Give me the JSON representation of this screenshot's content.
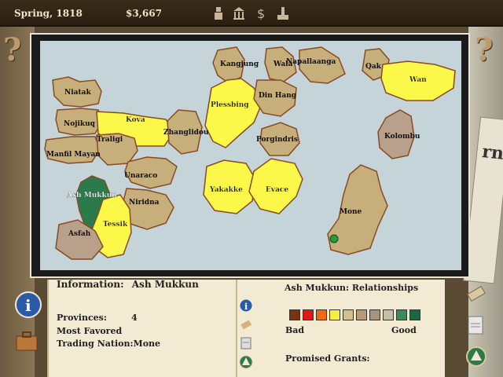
{
  "status": {
    "date": "Spring, 1818",
    "money": "$3,667"
  },
  "top_icons": [
    "figure-icon",
    "bank-icon",
    "dollar-icon",
    "anvil-icon"
  ],
  "help": {
    "left": "?",
    "right": "?"
  },
  "newspaper": {
    "masthead": "rna"
  },
  "map": {
    "regions": [
      {
        "name": "Niatak",
        "relation": "tan"
      },
      {
        "name": "Nojikuq",
        "relation": "tan"
      },
      {
        "name": "Manfil Mayan",
        "relation": "tan"
      },
      {
        "name": "Kova",
        "relation": "yellow"
      },
      {
        "name": "Traligi",
        "relation": "tan"
      },
      {
        "name": "Zhanglidou",
        "relation": "tan"
      },
      {
        "name": "Kangjung",
        "relation": "tan"
      },
      {
        "name": "Wala",
        "relation": "tan"
      },
      {
        "name": "Napallaanga",
        "relation": "tan"
      },
      {
        "name": "Qak",
        "relation": "tan"
      },
      {
        "name": "Wan",
        "relation": "yellow"
      },
      {
        "name": "Plessbing",
        "relation": "yellow"
      },
      {
        "name": "Din Hang",
        "relation": "tan"
      },
      {
        "name": "Porgindris",
        "relation": "tan"
      },
      {
        "name": "Kolombu",
        "relation": "mauve"
      },
      {
        "name": "Unaraco",
        "relation": "tan"
      },
      {
        "name": "Ash Mukkun",
        "relation": "selected"
      },
      {
        "name": "Niridna",
        "relation": "tan"
      },
      {
        "name": "Tessik",
        "relation": "yellow"
      },
      {
        "name": "Asfah",
        "relation": "mauve"
      },
      {
        "name": "Yakakke",
        "relation": "yellow"
      },
      {
        "name": "Evace",
        "relation": "yellow"
      },
      {
        "name": "Mone",
        "relation": "tan"
      }
    ]
  },
  "info": {
    "heading": "Information:",
    "selected": "Ash Mukkun",
    "provinces_label": "Provinces:",
    "provinces_value": "4",
    "favored_label": "Most Favored",
    "trading_label": "Trading Nation:Mone"
  },
  "relationships": {
    "title": "Ash Mukkun: Relationships",
    "bad": "Bad",
    "good": "Good",
    "scale_colors": [
      "#7a3414",
      "#e01818",
      "#f06a10",
      "#f8f040",
      "#d4c08a",
      "#b89a74",
      "#a8947c",
      "#c4c0a8",
      "#3a8a5a",
      "#186840"
    ],
    "grants_label": "Promised Grants:"
  },
  "colors": {
    "yellow": "#fbf84a",
    "tan": "#c7af7c",
    "mauve": "#b8a08a",
    "selected": "#2a7a4c",
    "border": "#8a4a24",
    "water": "#c4d4d8"
  }
}
